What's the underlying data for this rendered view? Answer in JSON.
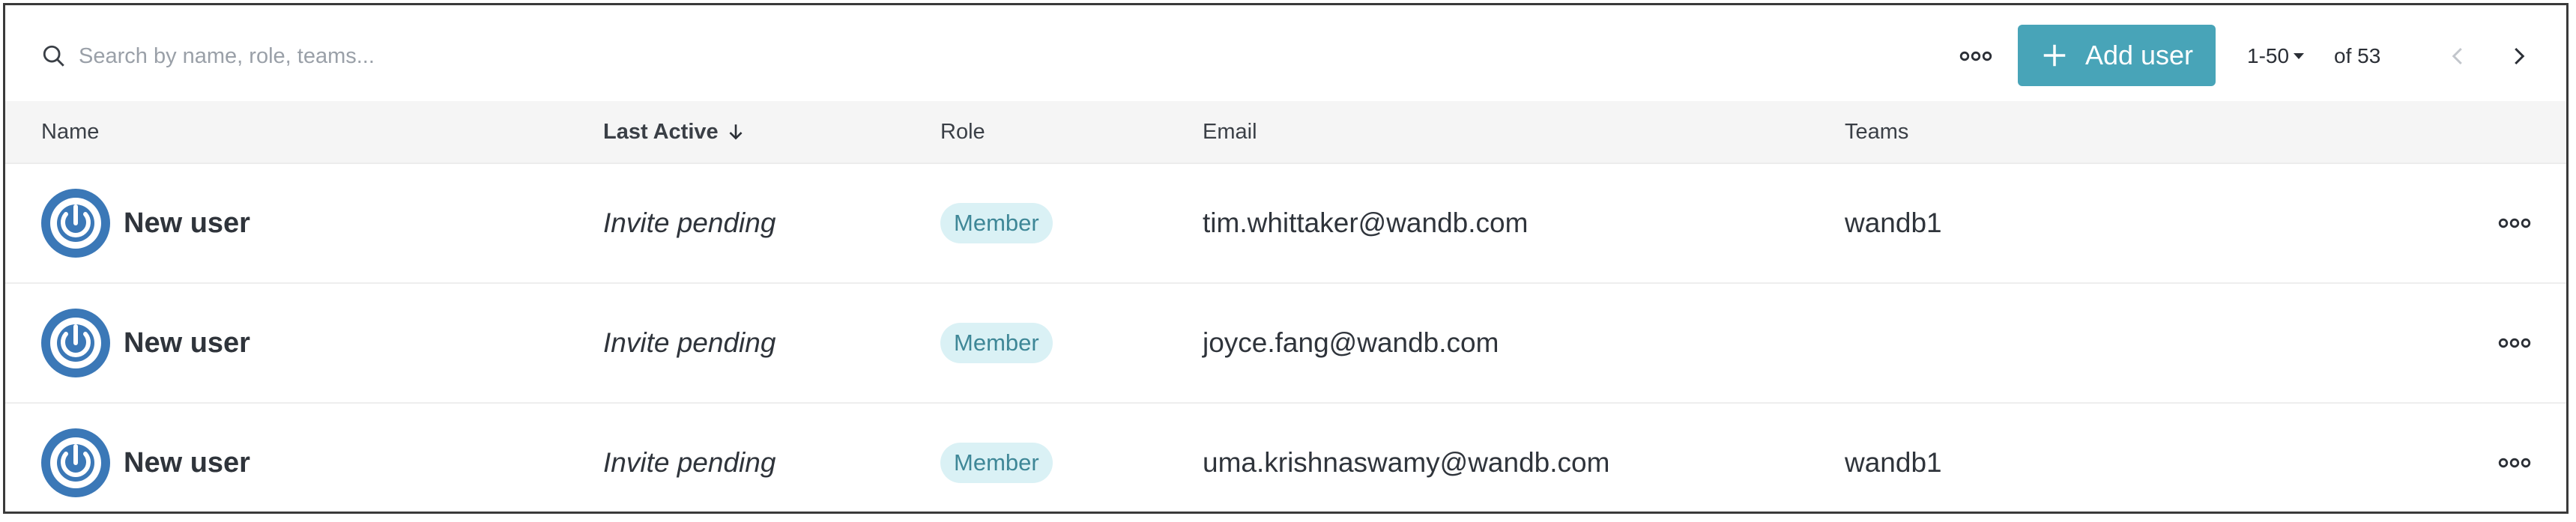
{
  "toolbar": {
    "search_placeholder": "Search by name, role, teams...",
    "add_user_label": "Add user",
    "pager_range": "1-50",
    "pager_total": "of 53",
    "icons": {
      "search": "search-icon",
      "more": "more-horizontal-icon",
      "add": "plus-icon",
      "prev": "chevron-left-icon",
      "next": "chevron-right-icon"
    }
  },
  "table": {
    "columns": {
      "name": "Name",
      "last_active": "Last Active",
      "role": "Role",
      "email": "Email",
      "teams": "Teams"
    },
    "sort_icon": "arrow-down-icon",
    "rows": [
      {
        "name": "New user",
        "last_active": "Invite pending",
        "role": "Member",
        "email": "tim.whittaker@wandb.com",
        "teams": "wandb1"
      },
      {
        "name": "New user",
        "last_active": "Invite pending",
        "role": "Member",
        "email": "joyce.fang@wandb.com",
        "teams": ""
      },
      {
        "name": "New user",
        "last_active": "Invite pending",
        "role": "Member",
        "email": "uma.krishnaswamy@wandb.com",
        "teams": "wandb1"
      }
    ]
  },
  "colors": {
    "accent": "#48a4b8",
    "badge_bg": "#daf1f5",
    "badge_text": "#3e8797",
    "avatar": "#3b78b7",
    "header_bg": "#f5f5f5"
  }
}
